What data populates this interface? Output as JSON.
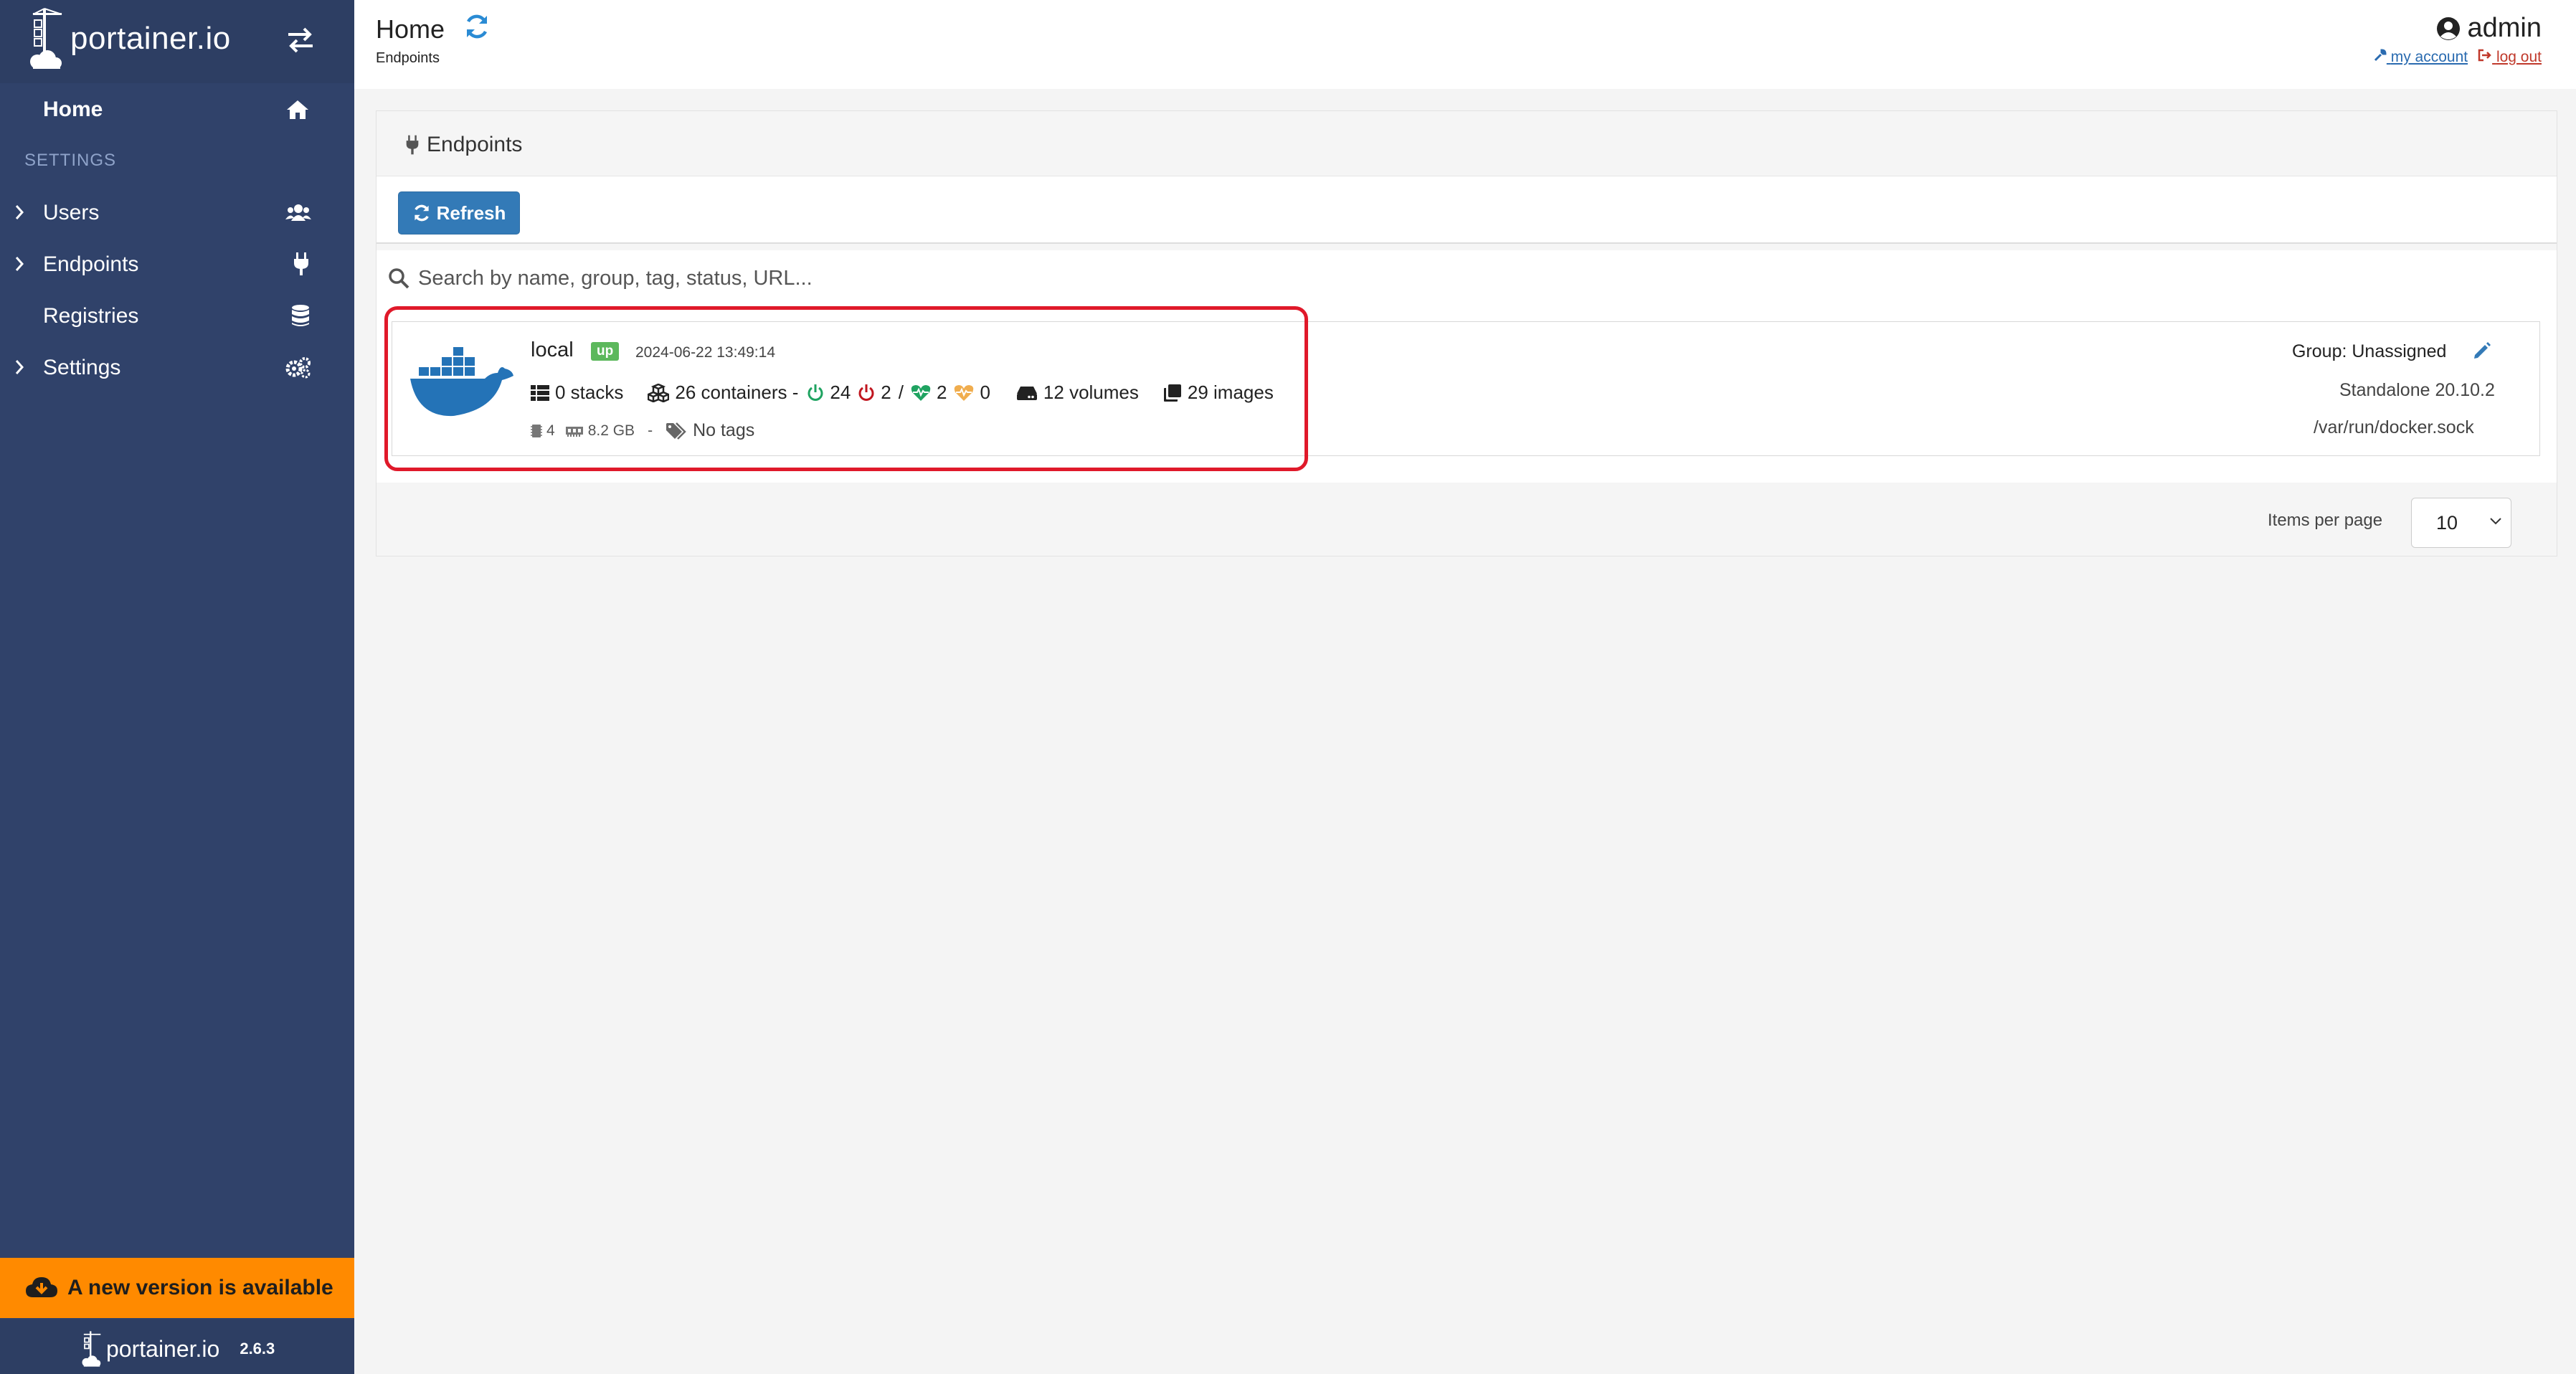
{
  "app": {
    "brand": "portainer.io",
    "version": "2.6.3"
  },
  "sidebar": {
    "home_label": "Home",
    "section_label": "SETTINGS",
    "items": [
      {
        "label": "Users",
        "icon": "users-icon",
        "expandable": true
      },
      {
        "label": "Endpoints",
        "icon": "plug-icon",
        "expandable": true
      },
      {
        "label": "Registries",
        "icon": "database-icon",
        "expandable": false
      },
      {
        "label": "Settings",
        "icon": "cogs-icon",
        "expandable": true
      }
    ],
    "update_banner": "A new version is available"
  },
  "header": {
    "title": "Home",
    "breadcrumb": "Endpoints",
    "user": "admin",
    "my_account": "my account",
    "log_out": "log out"
  },
  "panel": {
    "title": "Endpoints",
    "refresh_label": "Refresh",
    "search_placeholder": "Search by name, group, tag, status, URL..."
  },
  "endpoint": {
    "name": "local",
    "status": "up",
    "timestamp": "2024-06-22 13:49:14",
    "stacks": "0 stacks",
    "containers": "26 containers -",
    "running": "24",
    "stopped": "2",
    "slash": "/",
    "healthy": "2",
    "unhealthy": "0",
    "volumes": "12 volumes",
    "images": "29 images",
    "cpu": "4",
    "memory": "8.2 GB",
    "separator": "-",
    "tags": "No tags",
    "group": "Group: Unassigned",
    "engine": "Standalone 20.10.2",
    "url": "/var/run/docker.sock"
  },
  "pagination": {
    "items_per_page_label": "Items per page",
    "items_per_page_value": "10"
  },
  "colors": {
    "sidebar": "#30426a",
    "accent": "#337ab7",
    "banner": "#ff8a00",
    "status_up": "#5cb85c",
    "highlight": "#e0192a"
  }
}
